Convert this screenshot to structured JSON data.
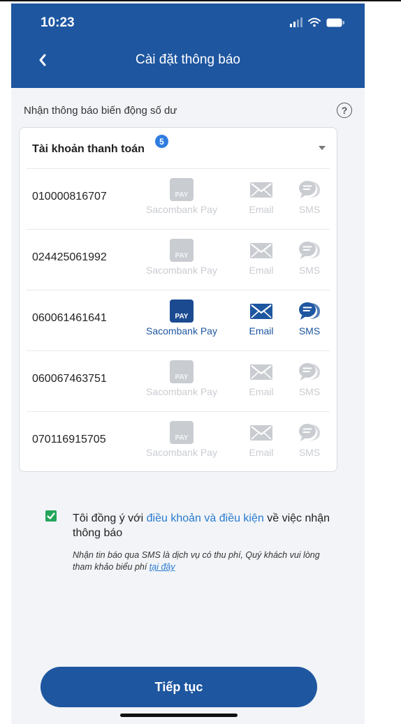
{
  "status_bar": {
    "time": "10:23"
  },
  "header": {
    "title": "Cài đặt thông báo"
  },
  "balance_notice": {
    "label": "Nhận thông báo biến động số dư"
  },
  "account_group": {
    "title": "Tài khoản thanh toán",
    "count": "5"
  },
  "pay_icon_text": "PAY",
  "channels": {
    "pay": "Sacombank Pay",
    "email": "Email",
    "sms": "SMS"
  },
  "colors": {
    "primary": "#1e56a0",
    "disabled": "#c9ccd1",
    "checkbox": "#25a55b",
    "badge": "#2f7de0"
  },
  "accounts": [
    {
      "number": "010000816707",
      "active": false
    },
    {
      "number": "024425061992",
      "active": false
    },
    {
      "number": "060061461641",
      "active": true
    },
    {
      "number": "060067463751",
      "active": false
    },
    {
      "number": "070116915705",
      "active": false
    }
  ],
  "consent": {
    "checked": true,
    "prefix": "Tôi đồng ý với ",
    "link": "điều khoản và điều kiện",
    "suffix": " về việc nhận thông báo"
  },
  "sms_note": {
    "text": "Nhận tin báo qua SMS là dịch vụ có thu phí, Quý khách vui lòng tham khảo biểu phí ",
    "link": "tại đây"
  },
  "continue_button": {
    "label": "Tiếp tục"
  }
}
